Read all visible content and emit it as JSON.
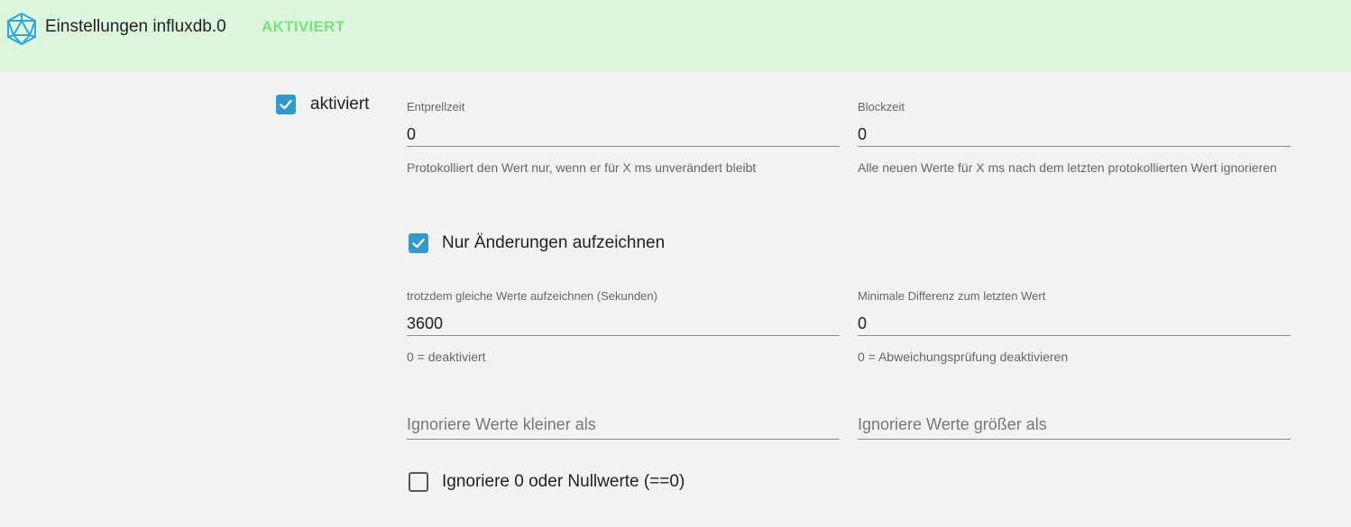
{
  "header": {
    "title": "Einstellungen influxdb.0",
    "status": "AKTIVIERT",
    "status_color": "#7de07f",
    "background": "#dcf5dd",
    "logo_icon": "icosahedron-icon"
  },
  "settings": {
    "enabled": {
      "label": "aktiviert",
      "checked": true
    },
    "debounce": {
      "label": "Entprellzeit",
      "value": "0",
      "help": "Protokolliert den Wert nur, wenn er für X ms unverändert bleibt"
    },
    "blocktime": {
      "label": "Blockzeit",
      "value": "0",
      "help": "Alle neuen Werte für X ms nach dem letzten protokollierten Wert ignorieren"
    },
    "changes_only": {
      "label": "Nur Änderungen aufzeichnen",
      "checked": true
    },
    "changes_relog": {
      "label": "trotzdem gleiche Werte aufzeichnen (Sekunden)",
      "value": "3600",
      "help": "0 = deaktiviert"
    },
    "min_difference": {
      "label": "Minimale Differenz zum letzten Wert",
      "value": "0",
      "help": "0 = Abweichungsprüfung deaktivieren"
    },
    "ignore_below": {
      "placeholder": "Ignoriere Werte kleiner als",
      "value": ""
    },
    "ignore_above": {
      "placeholder": "Ignoriere Werte größer als",
      "value": ""
    },
    "ignore_zero": {
      "label": "Ignoriere 0 oder Nullwerte (==0)",
      "checked": false
    }
  },
  "colors": {
    "checkbox_accent": "#3399cc"
  }
}
